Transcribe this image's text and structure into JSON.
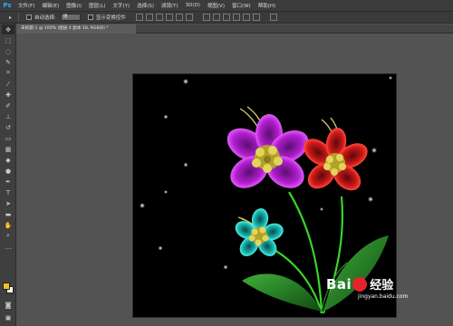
{
  "app": {
    "logo": "Ps"
  },
  "menubar": {
    "items": [
      "文件(F)",
      "编辑(E)",
      "图像(I)",
      "图层(L)",
      "文字(Y)",
      "选择(S)",
      "滤镜(T)",
      "3D(D)",
      "视图(V)",
      "窗口(W)",
      "帮助(H)"
    ]
  },
  "options": {
    "tool_glyph": "▸",
    "auto_select_label": "自动选择:",
    "auto_select_value": "组",
    "show_transform_label": "显示变换控件"
  },
  "document": {
    "tab_label": "未标题-1 @ 100% (图层 4 副本 18, RGB/8) *"
  },
  "colors": {
    "foreground": "#f2c21b",
    "background": "#ffffff",
    "ps_blue": "#31a8ff"
  },
  "watermark": {
    "brand_left": "Bai",
    "brand_right": "经验",
    "url": "jingyan.baidu.com"
  }
}
